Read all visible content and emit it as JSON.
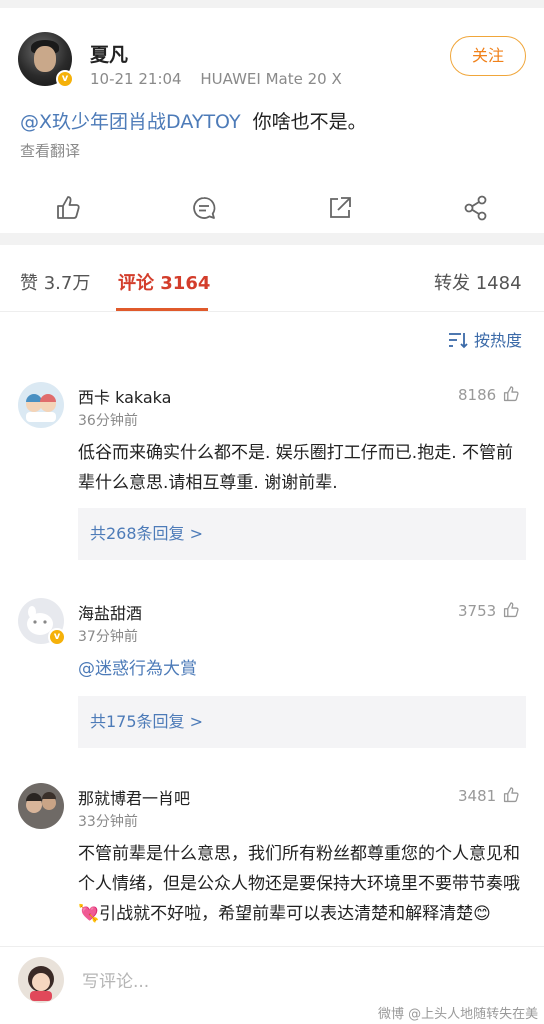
{
  "post": {
    "author": "夏凡",
    "time": "10-21 21:04",
    "device": "HUAWEI Mate 20 X",
    "follow_label": "关注",
    "mention": "@X玖少年团肖战DAYTOY",
    "text": "你啥也不是。",
    "translate_label": "查看翻译"
  },
  "tabs": {
    "likes": "赞 3.7万",
    "comments": "评论 3164",
    "reposts": "转发 1484"
  },
  "sort_label": "按热度",
  "comments": [
    {
      "name": "西卡 kakaka",
      "time": "36分钟前",
      "likes": "8186",
      "text": "低谷而来确实什么都不是. 娱乐圈打工仔而已.抱走. 不管前辈什么意思.请相互尊重. 谢谢前辈.",
      "replies": "共268条回复 >"
    },
    {
      "name": "海盐甜酒",
      "time": "37分钟前",
      "likes": "3753",
      "mention": "@迷惑行為大賞",
      "replies": "共175条回复 >"
    },
    {
      "name": "那就博君一肖吧",
      "time": "33分钟前",
      "likes": "3481",
      "text": "不管前辈是什么意思，我们所有粉丝都尊重您的个人意见和个人情绪，但是公众人物还是要保持大环境里不要带节奏哦💘引战就不好啦，希望前辈可以表达清楚和解释清楚😊"
    }
  ],
  "bottom": {
    "placeholder": "写评论...",
    "watermark": "微博 @上头人地随转失在美"
  },
  "icons": {
    "like": "thumbs-up-icon",
    "comment": "comment-icon",
    "share": "share-icon",
    "repost": "network-share-icon",
    "sort": "sort-icon"
  },
  "colors": {
    "accent": "#d33d2b",
    "link": "#4d7bb8",
    "follow": "#f0811a",
    "verified": "#f5b10a"
  }
}
